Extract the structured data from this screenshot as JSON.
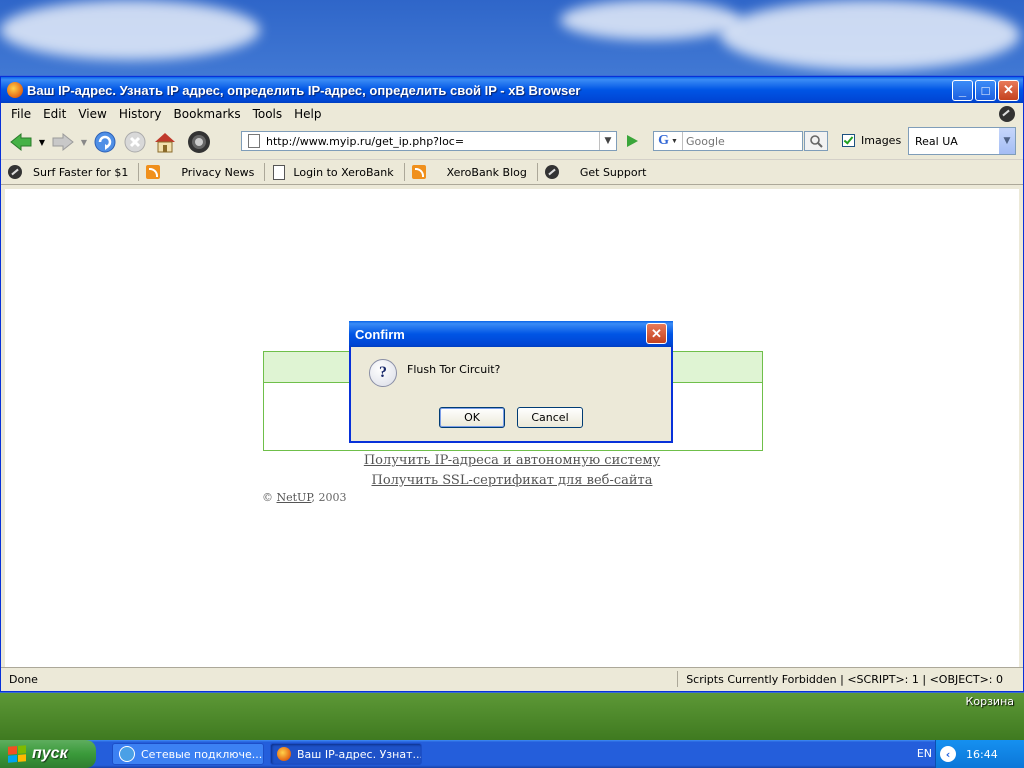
{
  "desktop": {
    "recycle_bin_label": "Корзина"
  },
  "window": {
    "title": "Ваш IP-адрес. Узнать IP адрес, определить IP-адрес, определить свой IP - xB Browser",
    "menu": [
      "File",
      "Edit",
      "View",
      "History",
      "Bookmarks",
      "Tools",
      "Help"
    ],
    "url": "http://www.myip.ru/get_ip.php?loc=",
    "search_placeholder": "Google",
    "images_label": "Images",
    "user_agent": "Real UA",
    "bookmarks": [
      {
        "label": "Surf Faster for $1",
        "icon": "xerobank-icon"
      },
      {
        "label": "Privacy News",
        "icon": "rss-icon"
      },
      {
        "label": "Login to XeroBank",
        "icon": "page-icon"
      },
      {
        "label": "XeroBank Blog",
        "icon": "rss-icon"
      },
      {
        "label": "Get Support",
        "icon": "xerobank-icon"
      }
    ],
    "status_left": "Done",
    "status_right": "Scripts Currently Forbidden | <SCRIPT>: 1 | <OBJECT>: 0"
  },
  "page": {
    "link1": "Получить IP-адреса и автономную систему",
    "link2": "Получить SSL-сертификат для веб-сайта",
    "copyright_prefix": "© ",
    "copyright_name": "NetUP",
    "copyright_suffix": ", 2003"
  },
  "dialog": {
    "title": "Confirm",
    "message": "Flush Tor Circuit?",
    "ok_label": "OK",
    "cancel_label": "Cancel"
  },
  "taskbar": {
    "start_label": "пуск",
    "tasks": [
      {
        "label": "Сетевые подключе...",
        "active": false
      },
      {
        "label": "Ваш IP-адрес. Узнат...",
        "active": true
      }
    ],
    "language": "EN",
    "clock": "16:44"
  }
}
